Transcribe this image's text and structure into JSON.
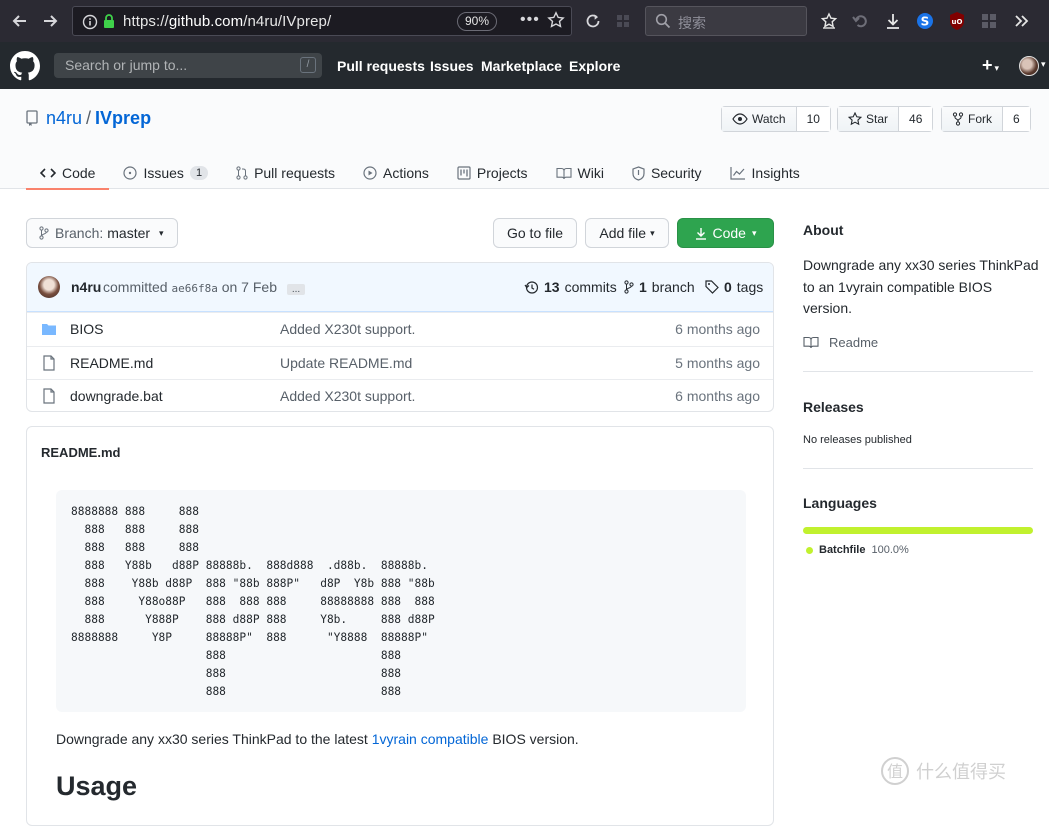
{
  "browser": {
    "url_prefix": "https://",
    "url_host": "github.com",
    "url_path": "/n4ru/IVprep/",
    "zoom": "90%",
    "search_placeholder": "搜索"
  },
  "header": {
    "search_placeholder": "Search or jump to...",
    "search_shortcut": "/",
    "nav": [
      "Pull requests",
      "Issues",
      "Marketplace",
      "Explore"
    ],
    "plus": "+"
  },
  "repo": {
    "owner": "n4ru",
    "separator": "/",
    "name": "IVprep",
    "watch_label": "Watch",
    "watch_count": "10",
    "star_label": "Star",
    "star_count": "46",
    "fork_label": "Fork",
    "fork_count": "6"
  },
  "tabs": [
    {
      "label": "Code",
      "icon": "code-icon"
    },
    {
      "label": "Issues",
      "icon": "issue-icon",
      "counter": "1"
    },
    {
      "label": "Pull requests",
      "icon": "pull-request-icon"
    },
    {
      "label": "Actions",
      "icon": "play-icon"
    },
    {
      "label": "Projects",
      "icon": "project-icon"
    },
    {
      "label": "Wiki",
      "icon": "book-icon"
    },
    {
      "label": "Security",
      "icon": "shield-icon"
    },
    {
      "label": "Insights",
      "icon": "graph-icon"
    }
  ],
  "toolbar": {
    "branch_label": "Branch:",
    "branch_name": "master",
    "go_to_file": "Go to file",
    "add_file": "Add file",
    "code": "Code"
  },
  "commit": {
    "user": "n4ru",
    "verb": "committed",
    "sha": "ae66f8a",
    "date": "on 7 Feb",
    "ellipsis": "...",
    "commits_count": "13",
    "commits_label": "commits",
    "branch_count": "1",
    "branch_label": "branch",
    "tags_count": "0",
    "tags_label": "tags"
  },
  "files": [
    {
      "name": "BIOS",
      "type": "folder",
      "message": "Added X230t support.",
      "age": "6 months ago"
    },
    {
      "name": "README.md",
      "type": "file",
      "message": "Update README.md",
      "age": "5 months ago"
    },
    {
      "name": "downgrade.bat",
      "type": "file",
      "message": "Added X230t support.",
      "age": "6 months ago"
    }
  ],
  "readme": {
    "title": "README.md",
    "ascii": [
      "8888888 888     888",
      "  888   888     888",
      "  888   888     888",
      "  888   Y88b   d88P 88888b.  888d888  .d88b.  88888b.",
      "  888    Y88b d88P  888 \"88b 888P\"   d8P  Y8b 888 \"88b",
      "  888     Y88o88P   888  888 888     88888888 888  888",
      "  888      Y888P    888 d88P 888     Y8b.     888 d88P",
      "8888888     Y8P     88888P\"  888      \"Y8888  88888P\"",
      "                    888                       888",
      "                    888                       888",
      "                    888                       888"
    ],
    "paragraph_before": "Downgrade any xx30 series ThinkPad to the latest ",
    "paragraph_link": "1vyrain compatible",
    "paragraph_after": " BIOS version.",
    "usage_heading": "Usage"
  },
  "sidebar": {
    "about_heading": "About",
    "about_text": "Downgrade any xx30 series ThinkPad to an 1vyrain compatible BIOS version.",
    "readme_link": "Readme",
    "releases_heading": "Releases",
    "releases_text": "No releases published",
    "languages_heading": "Languages",
    "language_name": "Batchfile",
    "language_percent": "100.0%",
    "language_color": "#c1f12e"
  },
  "watermark": "什么值得买"
}
